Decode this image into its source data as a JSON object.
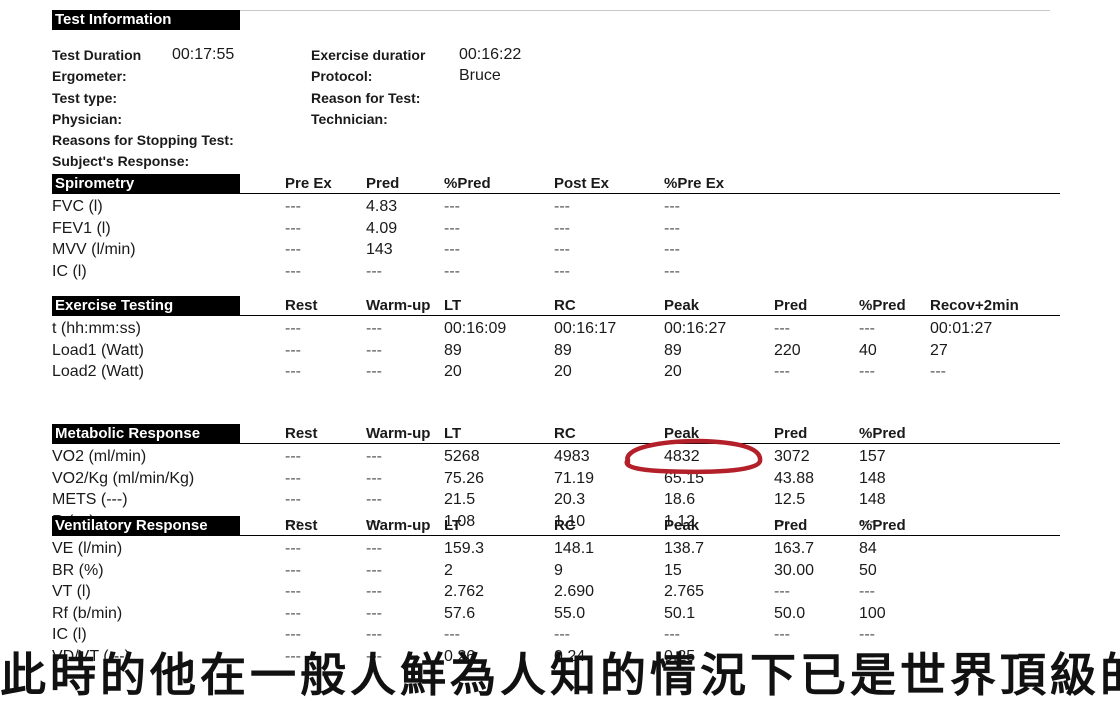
{
  "test_info": {
    "title": "Test Information",
    "left": [
      {
        "label": "Test Duration",
        "value": "00:17:55"
      },
      {
        "label": "Ergometer:",
        "value": ""
      },
      {
        "label": "Test type:",
        "value": ""
      },
      {
        "label": "Physician:",
        "value": ""
      },
      {
        "label": "Reasons for Stopping Test:",
        "value": ""
      },
      {
        "label": "Subject's Response:",
        "value": ""
      }
    ],
    "right": [
      {
        "label": "Exercise duratior",
        "value": "00:16:22"
      },
      {
        "label": "Protocol:",
        "value": "Bruce"
      },
      {
        "label": "Reason for Test:",
        "value": ""
      },
      {
        "label": "Technician:",
        "value": ""
      }
    ]
  },
  "sections": [
    {
      "title": "Spirometry",
      "headers": [
        "Pre Ex",
        "Pred",
        "%Pred",
        "Post Ex",
        "%Pre Ex"
      ],
      "rows": [
        {
          "label": "FVC (l)",
          "cells": [
            "---",
            "4.83",
            "---",
            "---",
            "---"
          ]
        },
        {
          "label": "FEV1 (l)",
          "cells": [
            "---",
            "4.09",
            "---",
            "---",
            "---"
          ]
        },
        {
          "label": "MVV (l/min)",
          "cells": [
            "---",
            "143",
            "---",
            "---",
            "---"
          ]
        },
        {
          "label": "IC (l)",
          "cells": [
            "---",
            "---",
            "---",
            "---",
            "---"
          ]
        }
      ]
    },
    {
      "title": "Exercise Testing",
      "headers": [
        "Rest",
        "Warm-up",
        "LT",
        "RC",
        "Peak",
        "Pred",
        "%Pred",
        "Recov+2min"
      ],
      "rows": [
        {
          "label": "t (hh:mm:ss)",
          "cells": [
            "---",
            "---",
            "00:16:09",
            "00:16:17",
            "00:16:27",
            "---",
            "---",
            "00:01:27"
          ]
        },
        {
          "label": "Load1 (Watt)",
          "cells": [
            "---",
            "---",
            "89",
            "89",
            "89",
            "220",
            "40",
            "27"
          ]
        },
        {
          "label": "Load2 (Watt)",
          "cells": [
            "---",
            "---",
            "20",
            "20",
            "20",
            "---",
            "---",
            "---"
          ]
        }
      ]
    },
    {
      "title": "Metabolic Response",
      "headers": [
        "Rest",
        "Warm-up",
        "LT",
        "RC",
        "Peak",
        "Pred",
        "%Pred"
      ],
      "rows": [
        {
          "label": "VO2 (ml/min)",
          "cells": [
            "---",
            "---",
            "5268",
            "4983",
            "4832",
            "3072",
            "157"
          ]
        },
        {
          "label": "VO2/Kg (ml/min/Kg)",
          "cells": [
            "---",
            "---",
            "75.26",
            "71.19",
            "65.15",
            "43.88",
            "148"
          ]
        },
        {
          "label": "METS (---)",
          "cells": [
            "---",
            "---",
            "21.5",
            "20.3",
            "18.6",
            "12.5",
            "148"
          ]
        },
        {
          "label": "R (---)",
          "cells": [
            "---",
            "---",
            "1.08",
            "1.10",
            "1.12",
            "---",
            "---"
          ]
        }
      ]
    },
    {
      "title": "Ventilatory Response",
      "headers": [
        "Rest",
        "Warm-up",
        "LT",
        "RC",
        "Peak",
        "Pred",
        "%Pred"
      ],
      "rows": [
        {
          "label": "VE (l/min)",
          "cells": [
            "---",
            "---",
            "159.3",
            "148.1",
            "138.7",
            "163.7",
            "84"
          ]
        },
        {
          "label": "BR (%)",
          "cells": [
            "---",
            "---",
            "2",
            "9",
            "15",
            "30.00",
            "50"
          ]
        },
        {
          "label": "VT (l)",
          "cells": [
            "---",
            "---",
            "2.762",
            "2.690",
            "2.765",
            "---",
            "---"
          ]
        },
        {
          "label": "Rf (b/min)",
          "cells": [
            "---",
            "---",
            "57.6",
            "55.0",
            "50.1",
            "50.0",
            "100"
          ]
        },
        {
          "label": "IC (l)",
          "cells": [
            "---",
            "---",
            "---",
            "---",
            "---",
            "---",
            "---"
          ]
        },
        {
          "label": "VD/VT (---)",
          "cells": [
            "---",
            "---",
            "0.26",
            "0.24",
            "0.25",
            "---",
            "---"
          ]
        }
      ]
    }
  ],
  "annotation": {
    "color": "#b3202a",
    "target": "65.15"
  },
  "caption": "此時的他在一般人鮮為人知的情況下已是世界頂級的自行車選手"
}
